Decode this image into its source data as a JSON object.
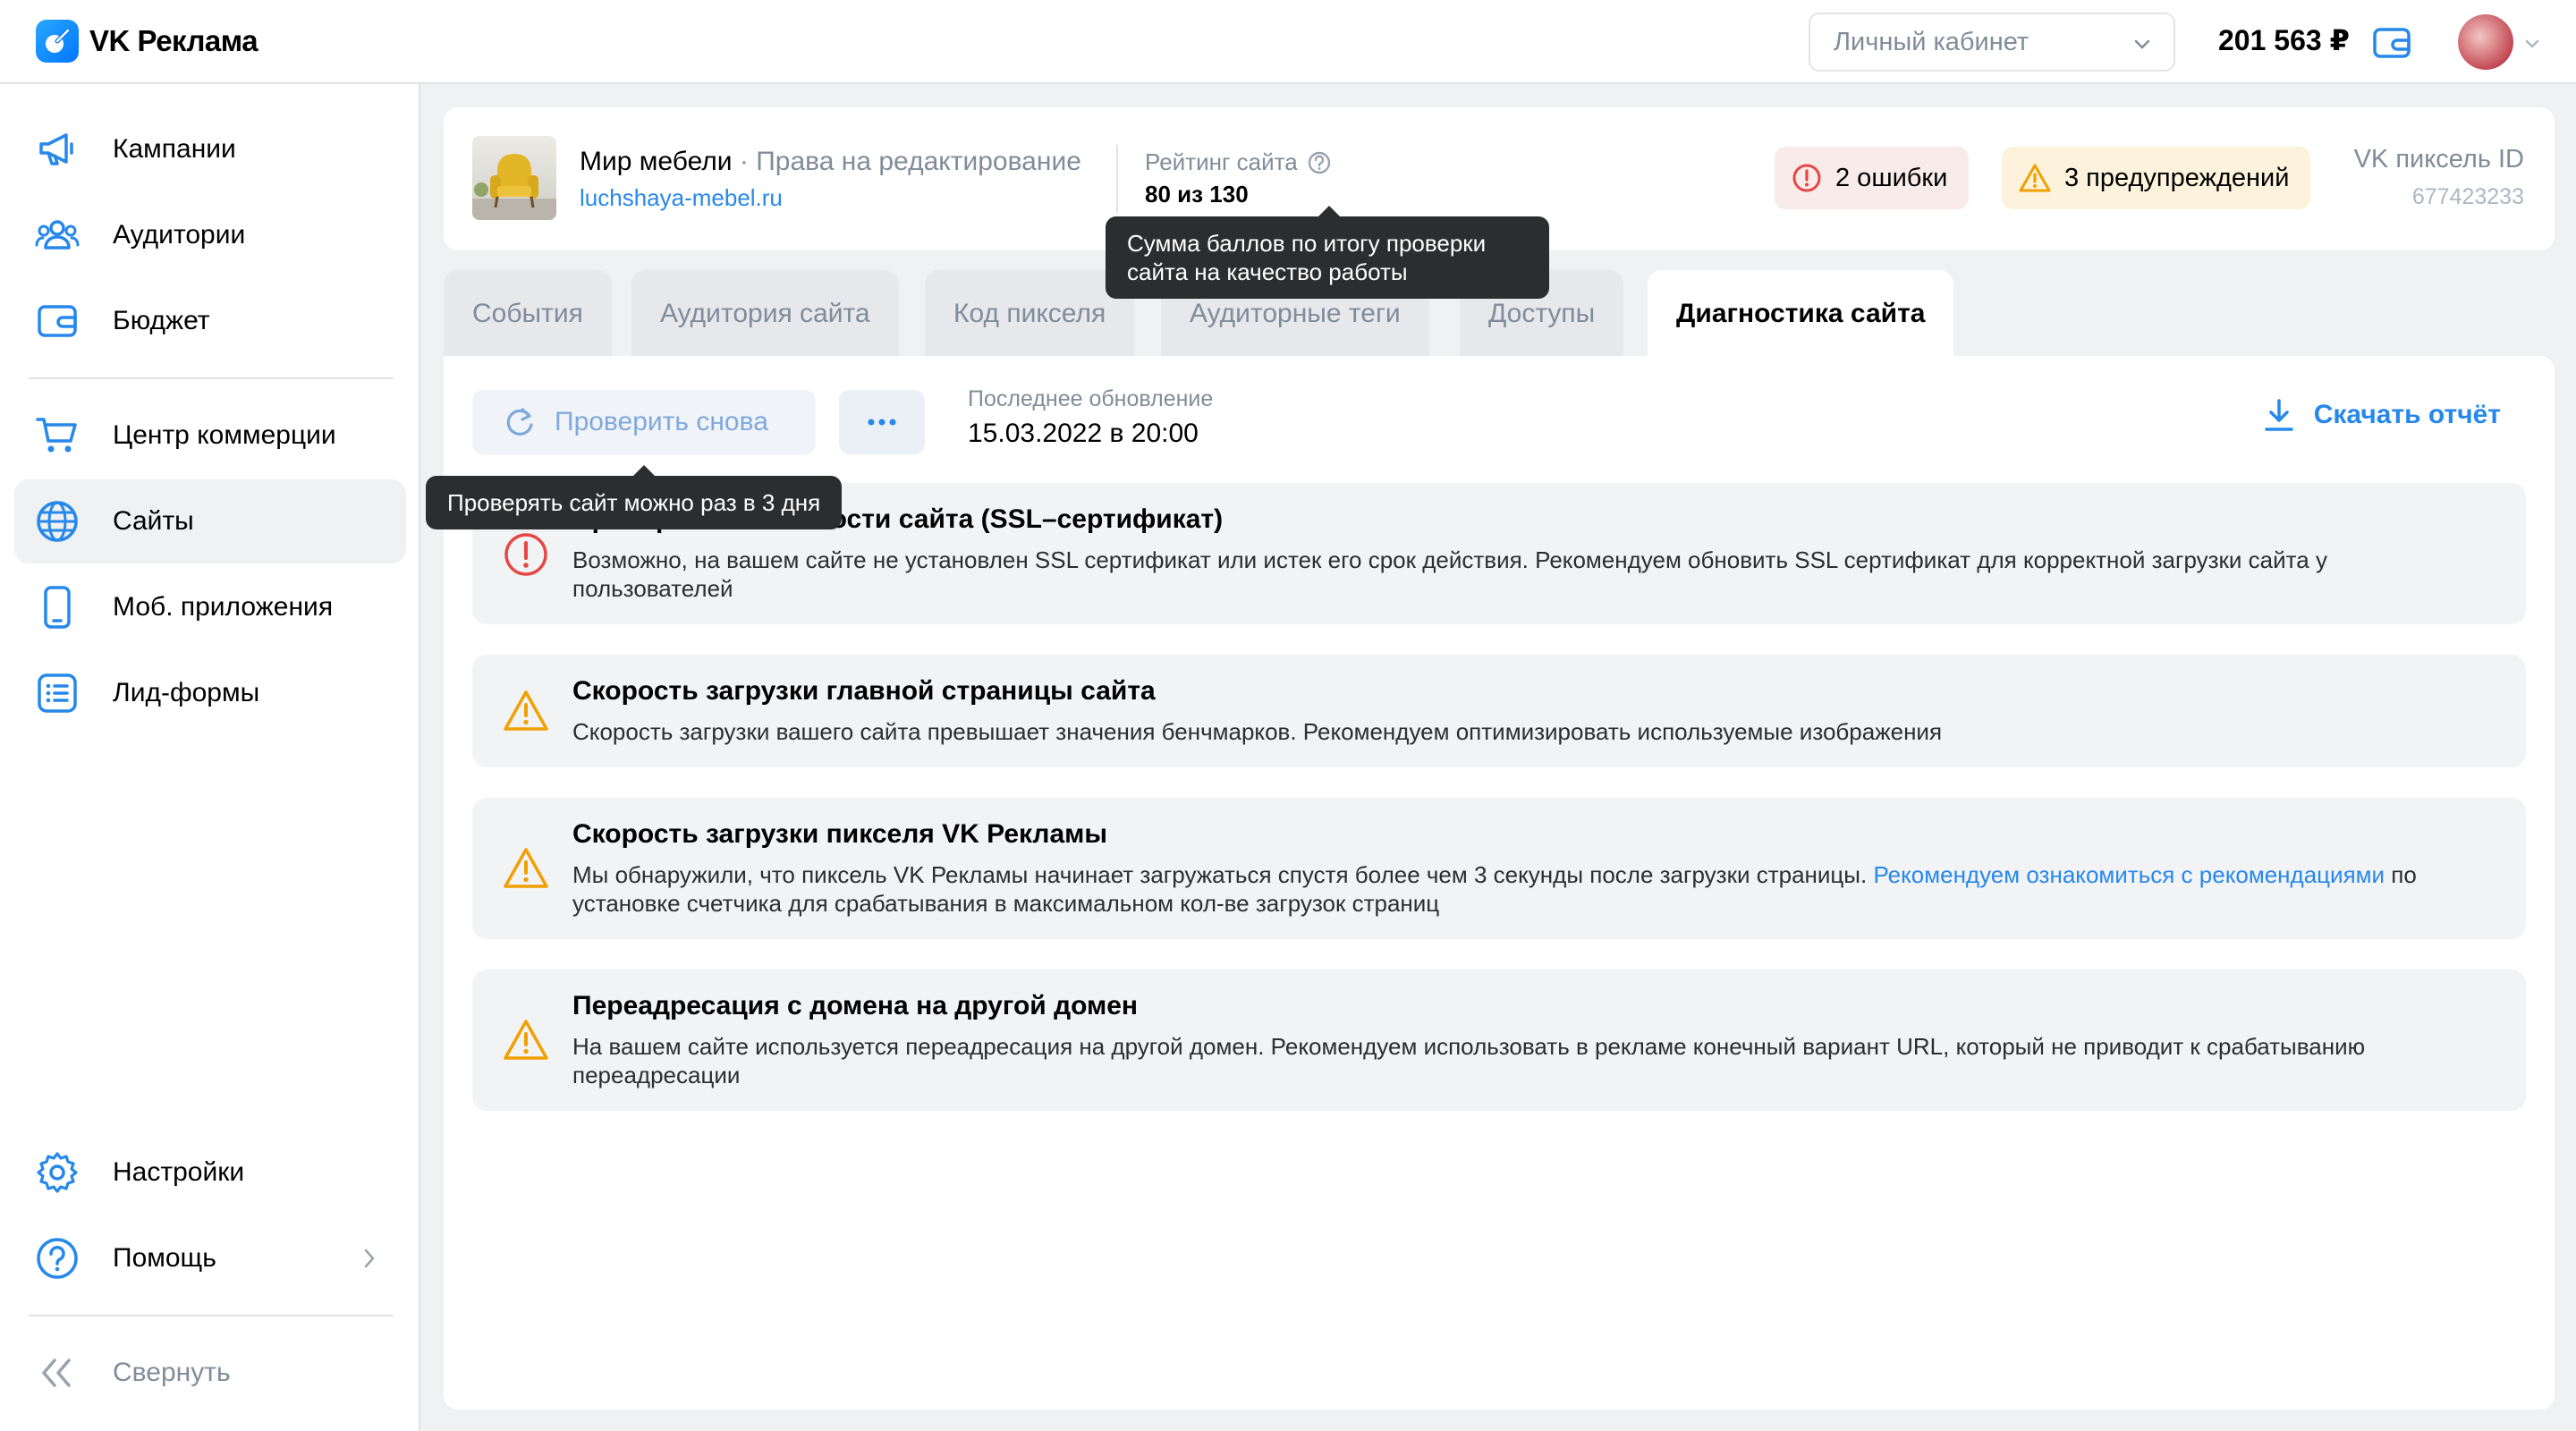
{
  "app": {
    "title": "VK Реклама"
  },
  "topbar": {
    "cabinet_select": "Личный кабинет",
    "balance": "201 563 ₽"
  },
  "sidebar": {
    "items": [
      {
        "label": "Кампании",
        "icon": "megaphone-icon"
      },
      {
        "label": "Аудитории",
        "icon": "users-icon"
      },
      {
        "label": "Бюджет",
        "icon": "wallet-icon"
      },
      {
        "label": "Центр коммерции",
        "icon": "cart-icon"
      },
      {
        "label": "Сайты",
        "icon": "globe-icon",
        "active": true
      },
      {
        "label": "Моб. приложения",
        "icon": "smartphone-icon"
      },
      {
        "label": "Лид-формы",
        "icon": "list-icon"
      },
      {
        "label": "Настройки",
        "icon": "gear-icon"
      },
      {
        "label": "Помощь",
        "icon": "help-icon"
      },
      {
        "label": "Свернуть",
        "icon": "collapse-icon"
      }
    ]
  },
  "site": {
    "name": "Мир мебели",
    "separator": " · ",
    "rights": "Права на редактирование",
    "link": "luchshaya-mebel.ru",
    "rating_label": "Рейтинг сайта",
    "rating_value": "80 из 130",
    "errors_badge": "2 ошибки",
    "warnings_badge": "3 предупреждений",
    "pixel_label": "VK пиксель ID",
    "pixel_id": "677423233"
  },
  "tabs": [
    {
      "label": "События"
    },
    {
      "label": "Аудитория сайта"
    },
    {
      "label": "Код пикселя"
    },
    {
      "label": "Аудиторные теги"
    },
    {
      "label": "Доступы"
    },
    {
      "label": "Диагностика сайта",
      "active": true
    }
  ],
  "toolbar": {
    "recheck_label": "Проверить снова",
    "last_update_label": "Последнее обновление",
    "last_update_value": "15.03.2022 в 20:00",
    "download_label": "Скачать отчёт"
  },
  "issues": [
    {
      "type": "error",
      "title": "Проверка безопасности сайта (SSL–сертификат)",
      "desc": "Возможно, на вашем сайте не установлен SSL сертификат или истек его срок действия. Рекомендуем обновить SSL сертификат для корректной загрузки сайта у пользователей"
    },
    {
      "type": "warning",
      "title": "Скорость загрузки главной страницы сайта",
      "desc": "Скорость загрузки вашего сайта превышает значения бенчмарков. Рекомендуем оптимизировать используемые изображения"
    },
    {
      "type": "warning",
      "title": "Скорость загрузки пикселя VK Рекламы",
      "desc_before": "Мы обнаружили, что пиксель VK Рекламы начинает загружаться спустя более чем 3 секунды после загрузки страницы. ",
      "desc_link": "Рекомендуем ознакомиться с рекомендациями",
      "desc_after": " по установке счетчика для срабатывания в максимальном кол-ве загрузок страниц"
    },
    {
      "type": "warning",
      "title": "Переадресация с домена на другой домен",
      "desc": "На вашем сайте используется переадресация на другой домен. Рекомендуем использовать в рекламе конечный вариант URL, который не приводит к срабатыванию переадресации"
    }
  ],
  "tooltips": {
    "rating_line1": "Сумма баллов по итогу проверки",
    "rating_line2": "сайта на качество работы",
    "recheck": "Проверять сайт можно раз в 3 дня"
  },
  "colors": {
    "accent": "#2688eb",
    "error": "#e64646",
    "warning": "#f0a000"
  }
}
